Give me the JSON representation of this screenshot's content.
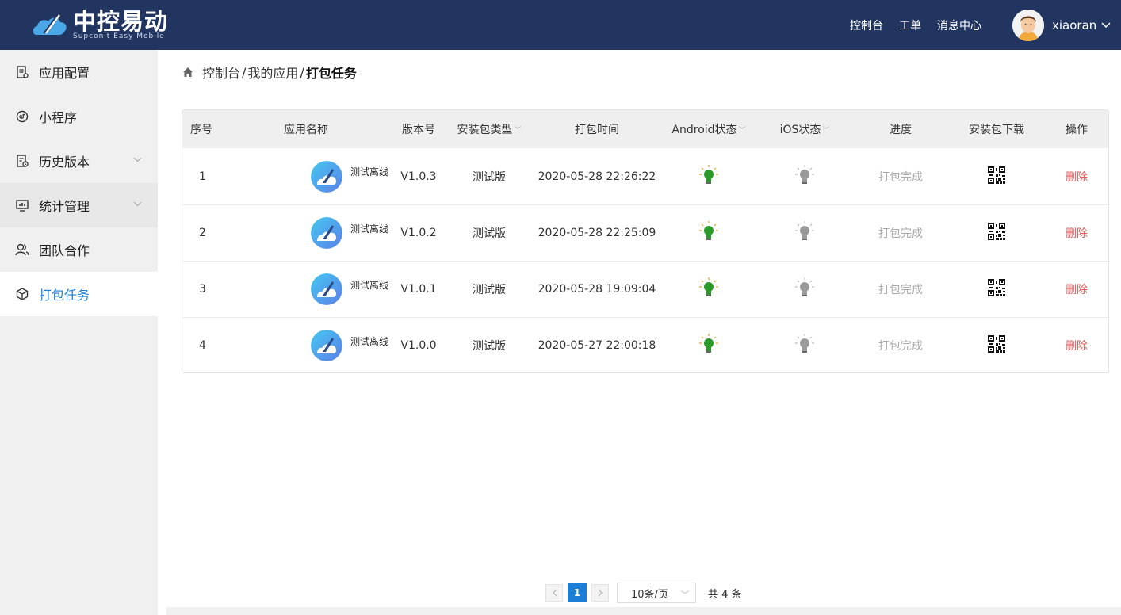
{
  "header": {
    "brand_cn": "中控易动",
    "brand_en": "Supconit Easy Mobile",
    "nav": [
      "控制台",
      "工单",
      "消息中心"
    ],
    "username": "xiaoran",
    "bg_color": "#213560"
  },
  "sidebar": {
    "items": [
      {
        "label": "应用配置",
        "icon": "app-config-icon"
      },
      {
        "label": "小程序",
        "icon": "mini-program-icon"
      },
      {
        "label": "历史版本",
        "icon": "history-icon"
      },
      {
        "label": "统计管理",
        "icon": "statistics-icon"
      },
      {
        "label": "团队合作",
        "icon": "team-icon"
      },
      {
        "label": "打包任务",
        "icon": "package-icon"
      }
    ],
    "active": "打包任务",
    "active_color": "#1c7ed6"
  },
  "breadcrumb": {
    "items": [
      "控制台",
      "我的应用"
    ],
    "current": "打包任务",
    "sep": "/"
  },
  "table": {
    "headers": [
      "序号",
      "应用名称",
      "版本号",
      "安装包类型",
      "打包时间",
      "Android状态",
      "iOS状态",
      "进度",
      "安装包下载",
      "操作"
    ],
    "rows": [
      {
        "no": "1",
        "app": "测试离线",
        "version": "V1.0.3",
        "type": "测试版",
        "time": "2020-05-28 22:26:22",
        "android": "on",
        "ios": "off",
        "progress": "打包完成",
        "action": "删除"
      },
      {
        "no": "2",
        "app": "测试离线",
        "version": "V1.0.2",
        "type": "测试版",
        "time": "2020-05-28 22:25:09",
        "android": "on",
        "ios": "off",
        "progress": "打包完成",
        "action": "删除"
      },
      {
        "no": "3",
        "app": "测试离线",
        "version": "V1.0.1",
        "type": "测试版",
        "time": "2020-05-28 19:09:04",
        "android": "on",
        "ios": "off",
        "progress": "打包完成",
        "action": "删除"
      },
      {
        "no": "4",
        "app": "测试离线",
        "version": "V1.0.0",
        "type": "测试版",
        "time": "2020-05-27 22:00:18",
        "android": "on",
        "ios": "off",
        "progress": "打包完成",
        "action": "删除"
      }
    ]
  },
  "pagination": {
    "current": "1",
    "page_size": "10条/页",
    "total": "共 4 条"
  }
}
